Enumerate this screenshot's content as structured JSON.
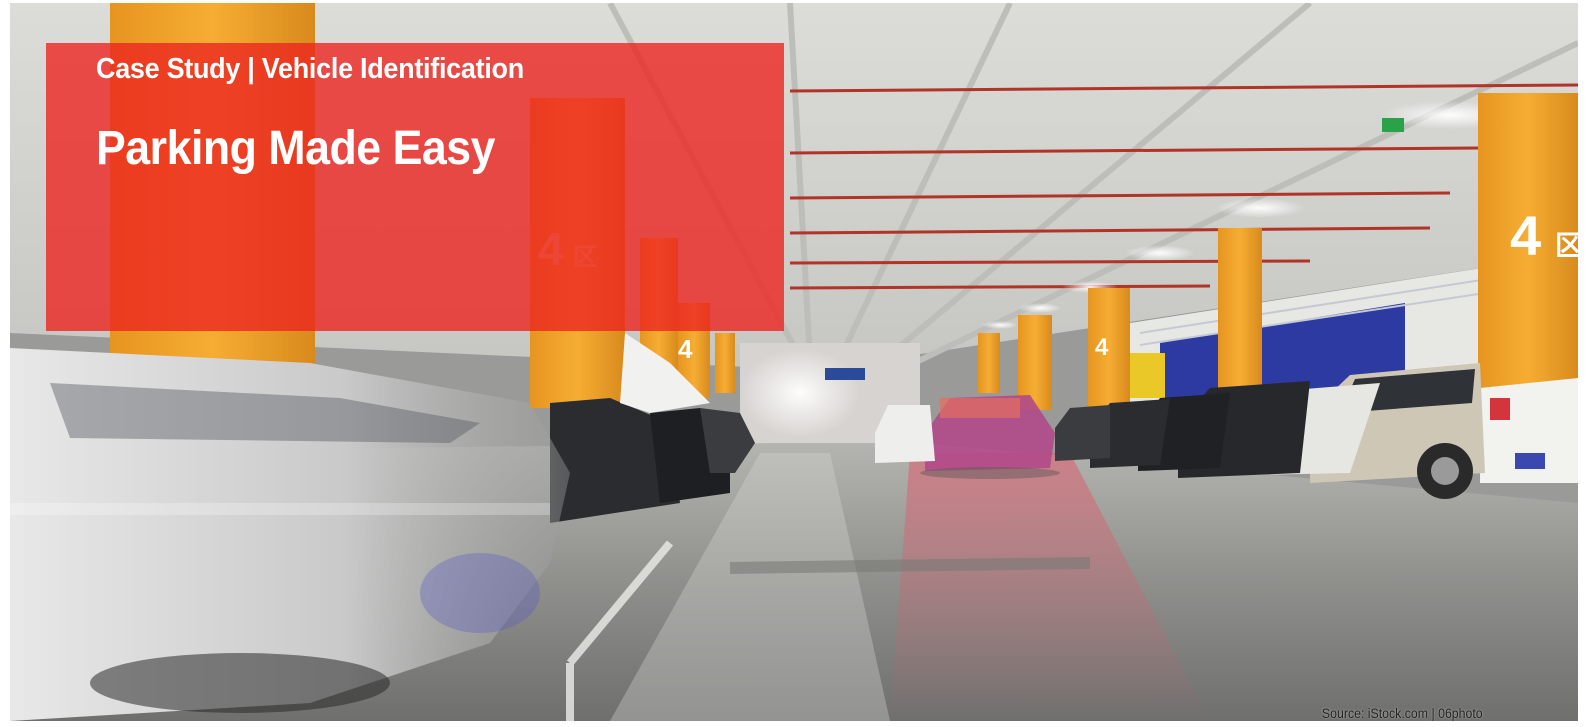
{
  "banner": {
    "kicker": "Case Study | Vehicle Identification",
    "headline": "Parking Made Easy",
    "credit": "Source: iStock.com  |  06photo"
  },
  "photo": {
    "subject": "underground parking garage with a blurred moving car",
    "pillar_markings": [
      "4区",
      "4区",
      "4区",
      "4区"
    ]
  },
  "colors": {
    "panel": "#ec2620",
    "pillar": "#f0a22a",
    "text": "#ffffff",
    "wall_blue": "#2f3a9e"
  }
}
